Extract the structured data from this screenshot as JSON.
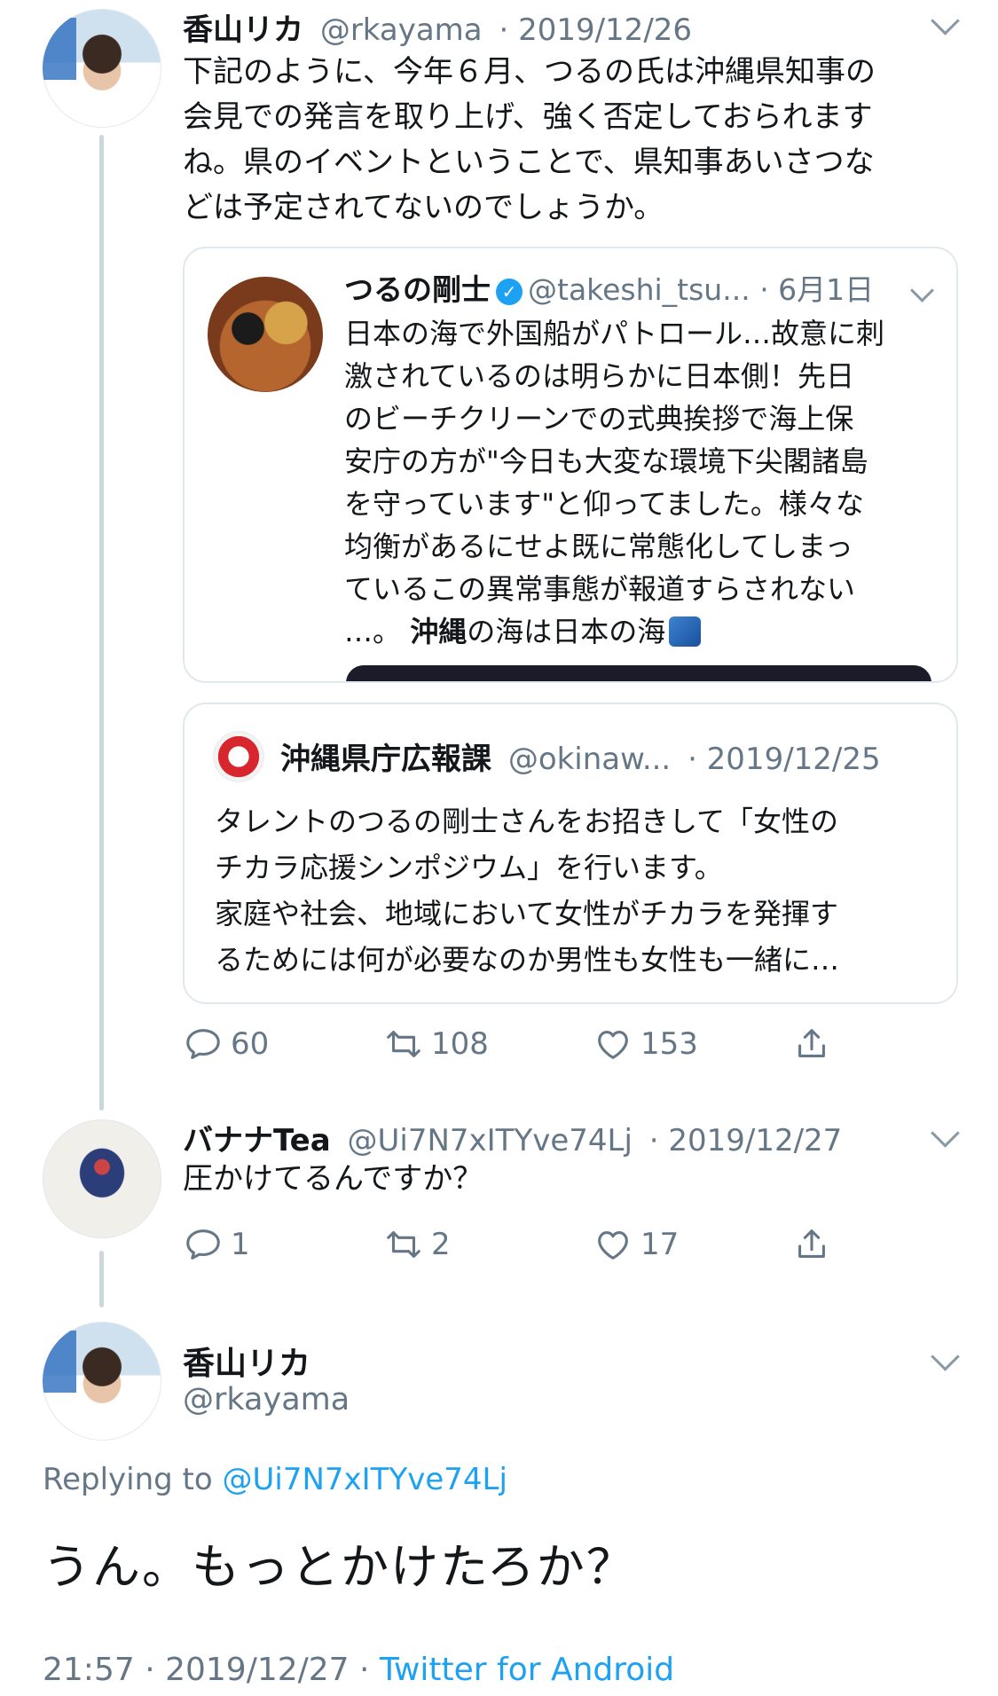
{
  "tweet1": {
    "name": "香山リカ",
    "handle": "@rkayama",
    "date": "· 2019/12/26",
    "text": "下記のように、今年６月、つるの氏は沖縄県知事の\n会見での発言を取り上げ、強く否定しておられます\nね。県のイベントということで、県知事あいさつな\nどは予定されてないのでしょうか。",
    "quote1": {
      "name": "つるの剛士",
      "verified_mark": "✓",
      "handle": "@takeshi_tsu...",
      "date": "· 6月1日",
      "text": "日本の海で外国船がパトロール…故意に刺\n激されているのは明らかに日本側！先日\nのビーチクリーンでの式典挨拶で海上保\n安庁の方が\"今日も大変な環境下尖閣諸島\nを守っています\"と仰ってました。様々な\n均衡があるにせよ既に常態化してしまっ\nているこの異常事態が報道すらされない\n…。",
      "text_bold": "沖縄",
      "text_tail": "の海は日本の海"
    },
    "quote2": {
      "name": "沖縄県庁広報課",
      "handle": "@okinaw...",
      "date": "· 2019/12/25",
      "text": "タレントのつるの剛士さんをお招きして「女性の\nチカラ応援シンポジウム」を行います。\n家庭や社会、地域において女性がチカラを発揮す\nるためには何が必要なのか男性も女性も一緒に…"
    },
    "stats": {
      "replies": "60",
      "retweets": "108",
      "likes": "153"
    }
  },
  "tweet2": {
    "name": "バナナTea",
    "handle": "@Ui7N7xITYve74Lj",
    "date": "· 2019/12/27",
    "text": "圧かけてるんですか？",
    "stats": {
      "replies": "1",
      "retweets": "2",
      "likes": "17"
    }
  },
  "main_tweet": {
    "name": "香山リカ",
    "handle": "@rkayama",
    "replying_label": "Replying to",
    "replying_handle": "@Ui7N7xITYve74Lj",
    "text": "うん。もっとかけたろか？",
    "time": "21:57 · 2019/12/27 ·",
    "source": "Twitter for Android"
  },
  "icons": {
    "reply": "reply-icon",
    "retweet": "retweet-icon",
    "like": "heart-icon",
    "share": "share-icon",
    "more": "chevron-down-icon"
  },
  "colors": {
    "link": "#1da1f2",
    "secondary": "#657786",
    "thread_line": "#ccd6dd",
    "border": "#e1e8ed"
  }
}
